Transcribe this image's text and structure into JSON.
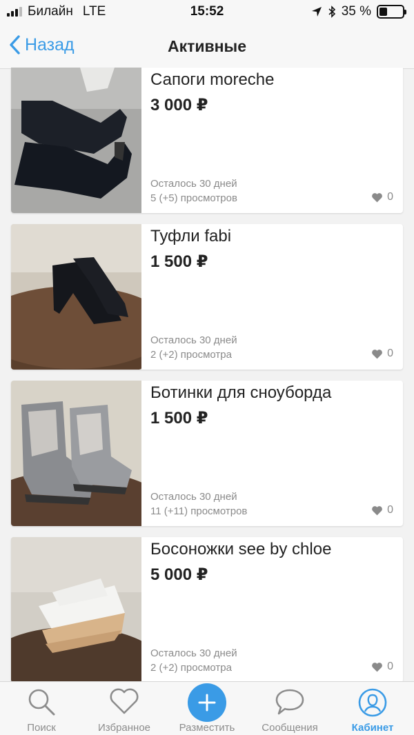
{
  "status_bar": {
    "carrier": "Билайн",
    "network": "LTE",
    "time": "15:52",
    "battery_percent": "35 %",
    "battery_level": 0.35
  },
  "nav": {
    "back_label": "Назад",
    "title": "Активные"
  },
  "listings": [
    {
      "title": "Сапоги moreche",
      "price": "3 000 ₽",
      "time_left": "Осталось 30 дней",
      "views": "5 (+5) просмотров",
      "likes": "0",
      "image": "black-suede-boots-photo"
    },
    {
      "title": "Туфли fabi",
      "price": "1 500 ₽",
      "time_left": "Осталось 30 дней",
      "views": "2 (+2) просмотра",
      "likes": "0",
      "image": "black-peep-toe-heels-photo"
    },
    {
      "title": "Ботинки для сноуборда",
      "price": "1 500 ₽",
      "time_left": "Осталось 30 дней",
      "views": "11 (+11) просмотров",
      "likes": "0",
      "image": "snowboard-boots-photo"
    },
    {
      "title": "Босоножки see by chloe",
      "price": "5 000 ₽",
      "time_left": "Осталось 30 дней",
      "views": "2 (+2) просмотра",
      "likes": "0",
      "image": "white-wedge-sandals-photo"
    }
  ],
  "tabs": [
    {
      "label": "Поиск",
      "icon": "search-icon",
      "active": false
    },
    {
      "label": "Избранное",
      "icon": "heart-icon",
      "active": false
    },
    {
      "label": "Разместить",
      "icon": "plus-icon",
      "active": false
    },
    {
      "label": "Сообщения",
      "icon": "chat-bubble-icon",
      "active": false
    },
    {
      "label": "Кабинет",
      "icon": "profile-icon",
      "active": true
    }
  ],
  "colors": {
    "accent": "#3a9be6",
    "background": "#f2f2f2",
    "muted_text": "#8a8a8a"
  }
}
